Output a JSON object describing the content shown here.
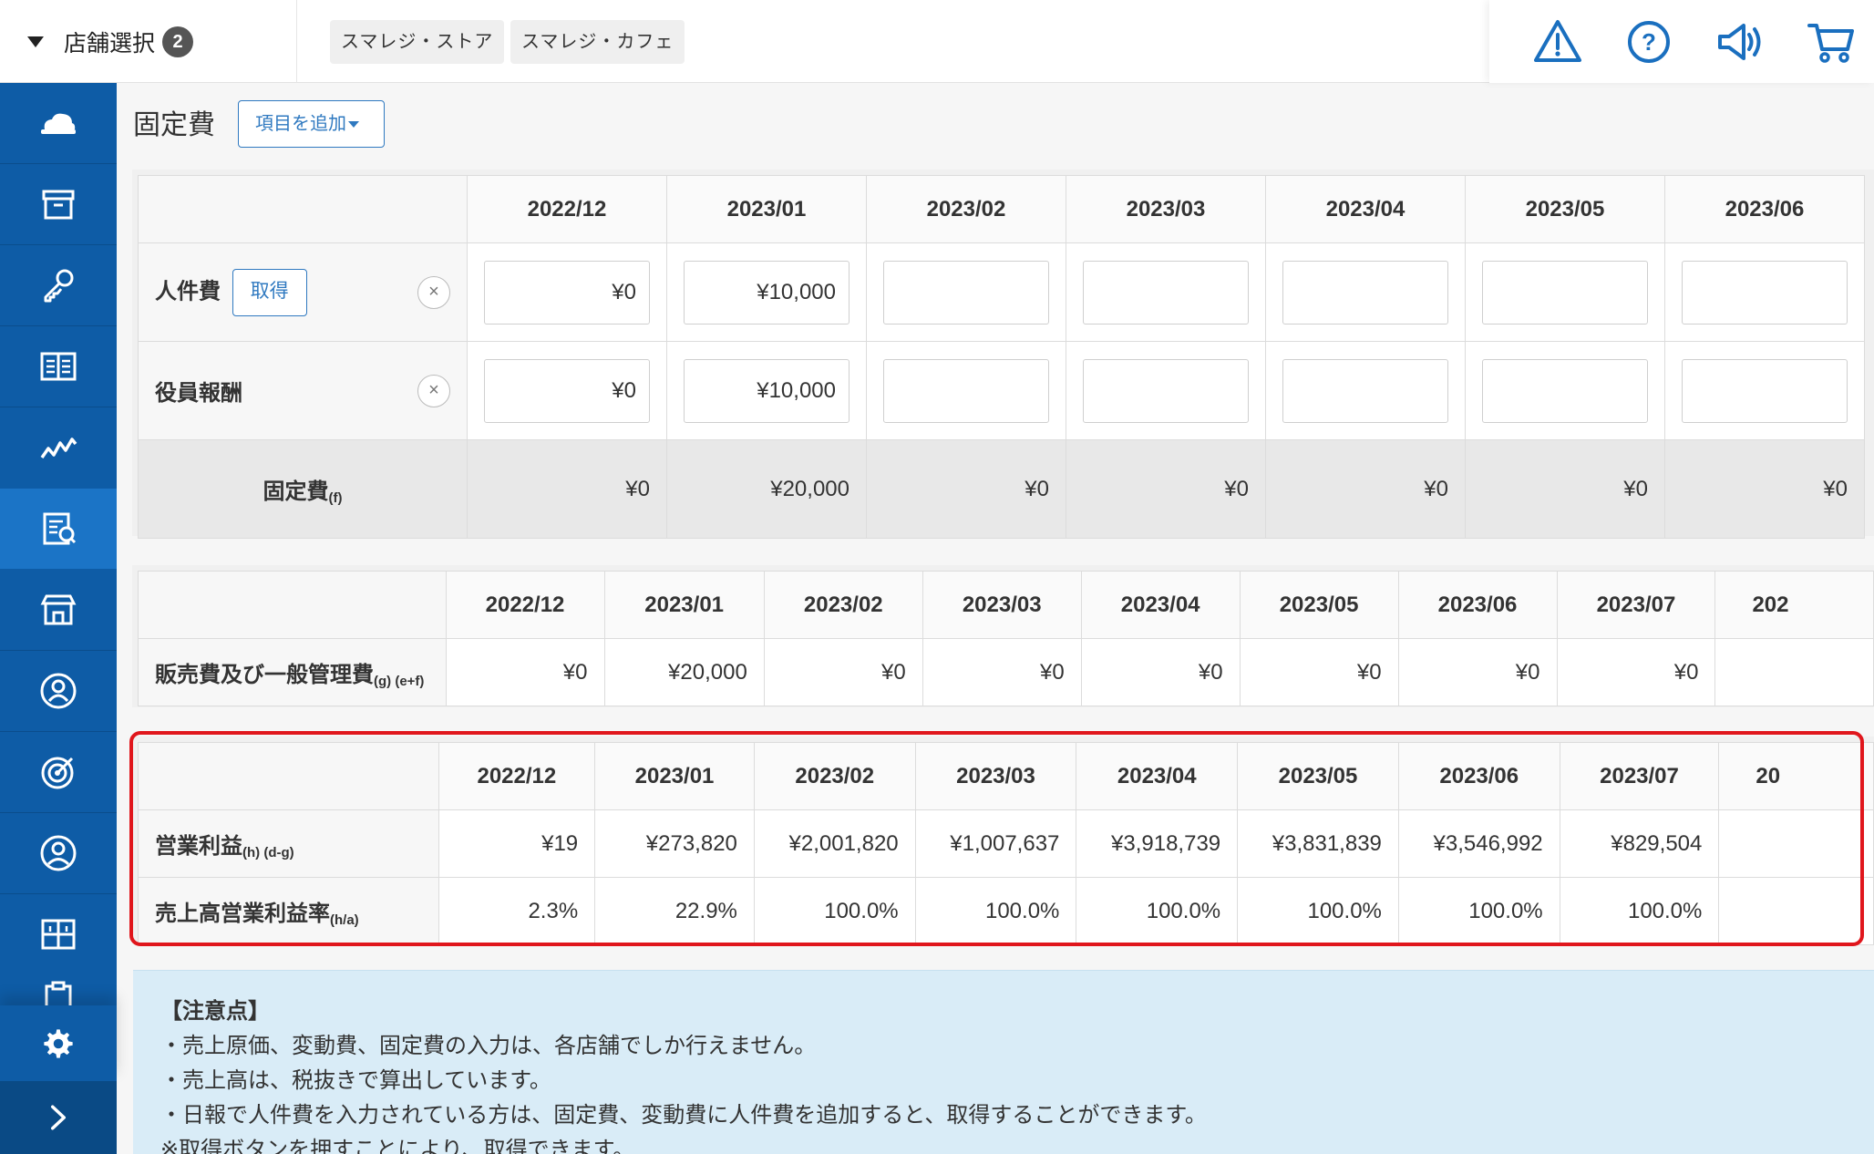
{
  "header": {
    "store_select_label": "店舗選択",
    "store_count": "2",
    "stores": [
      "スマレジ・ストア",
      "スマレジ・カフェ"
    ],
    "icons": [
      "warning-icon",
      "help-icon",
      "announcement-icon",
      "cart-icon"
    ]
  },
  "sidebar": {
    "items": [
      "cloud-icon",
      "archive-icon",
      "key-icon",
      "book-icon",
      "analytics-icon",
      "report-icon",
      "store-icon",
      "user-icon",
      "target-icon",
      "profile-icon",
      "apps-icon",
      "clipboard-icon",
      "gear-icon",
      "chevron-right-icon"
    ],
    "active_index": 5
  },
  "fixed_costs": {
    "title": "固定費",
    "add_button": "項目を追加",
    "months": [
      "2022/12",
      "2023/01",
      "2023/02",
      "2023/03",
      "2023/04",
      "2023/05",
      "2023/06"
    ],
    "rows": [
      {
        "label": "人件費",
        "get_button": "取得",
        "values": [
          "¥0",
          "¥10,000",
          "",
          "",
          "",
          "",
          ""
        ]
      },
      {
        "label": "役員報酬",
        "values": [
          "¥0",
          "¥10,000",
          "",
          "",
          "",
          "",
          ""
        ]
      }
    ],
    "total": {
      "label": "固定費",
      "sub": "(f)",
      "values": [
        "¥0",
        "¥20,000",
        "¥0",
        "¥0",
        "¥0",
        "¥0",
        "¥0"
      ]
    }
  },
  "sga": {
    "months": [
      "2022/12",
      "2023/01",
      "2023/02",
      "2023/03",
      "2023/04",
      "2023/05",
      "2023/06",
      "2023/07",
      "202"
    ],
    "label": "販売費及び一般管理費",
    "sub": "(g) (e+f)",
    "values": [
      "¥0",
      "¥20,000",
      "¥0",
      "¥0",
      "¥0",
      "¥0",
      "¥0",
      "¥0",
      ""
    ]
  },
  "operating": {
    "months": [
      "2022/12",
      "2023/01",
      "2023/02",
      "2023/03",
      "2023/04",
      "2023/05",
      "2023/06",
      "2023/07",
      "20"
    ],
    "rows": [
      {
        "label": "営業利益",
        "sub": "(h) (d-g)",
        "values": [
          "¥19",
          "¥273,820",
          "¥2,001,820",
          "¥1,007,637",
          "¥3,918,739",
          "¥3,831,839",
          "¥3,546,992",
          "¥829,504",
          ""
        ]
      },
      {
        "label": "売上高営業利益率",
        "sub": "(h/a)",
        "values": [
          "2.3%",
          "22.9%",
          "100.0%",
          "100.0%",
          "100.0%",
          "100.0%",
          "100.0%",
          "100.0%",
          ""
        ]
      }
    ]
  },
  "notes": {
    "title": "【注意点】",
    "lines": [
      "・売上原価、変動費、固定費の入力は、各店舗でしか行えません。",
      "・売上高は、税抜きで算出しています。",
      "・日報で人件費を入力されている方は、固定費、変動費に人件費を追加すると、取得することができます。",
      "※取得ボタンを押すことにより、取得できます。"
    ]
  }
}
